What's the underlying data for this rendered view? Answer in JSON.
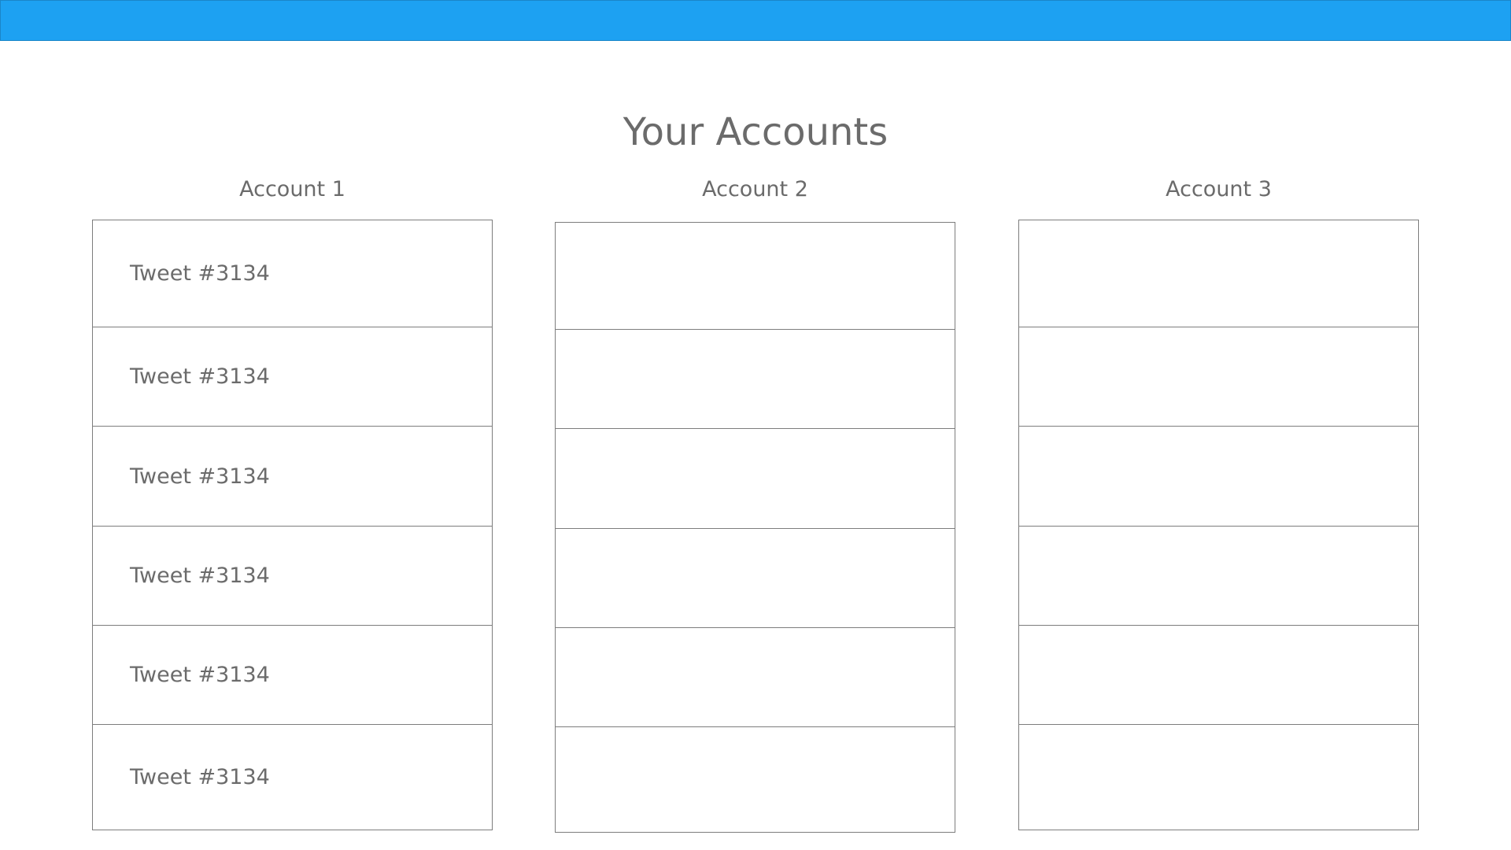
{
  "page": {
    "title": "Your Accounts"
  },
  "colors": {
    "top_bar": "#1da1f2",
    "text": "#6b6b6b",
    "border": "#7d7d7d",
    "background": "#ffffff"
  },
  "accounts": [
    {
      "name": "Account 1",
      "tweets": [
        "Tweet #3134",
        "Tweet #3134",
        "Tweet #3134",
        "Tweet #3134",
        "Tweet #3134",
        "Tweet #3134"
      ]
    },
    {
      "name": "Account 2",
      "tweets": [
        "",
        "",
        "",
        "",
        "",
        ""
      ]
    },
    {
      "name": "Account 3",
      "tweets": [
        "",
        "",
        "",
        "",
        "",
        ""
      ]
    }
  ]
}
